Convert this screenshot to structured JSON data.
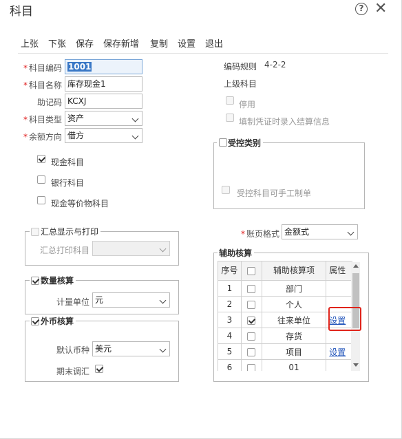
{
  "dialog": {
    "title": "科目"
  },
  "toolbar": {
    "prev": "上张",
    "next": "下张",
    "save": "保存",
    "save_new": "保存新增",
    "copy": "复制",
    "settings": "设置",
    "exit": "退出"
  },
  "form": {
    "code_label": "科目编码",
    "code_value": "1001",
    "name_label": "科目名称",
    "name_value": "库存现金1",
    "mnemonic_label": "助记码",
    "mnemonic_value": "KCXJ",
    "type_label": "科目类型",
    "type_value": "资产",
    "direction_label": "余额方向",
    "direction_value": "借方",
    "cash_label": "现金科目",
    "bank_label": "银行科目",
    "equiv_label": "现金等价物科目"
  },
  "right": {
    "code_rule_label": "编码规则",
    "code_rule_value": "4-2-2",
    "parent_label": "上级科目",
    "disabled_label": "停用",
    "settle_label": "填制凭证时录入结算信息",
    "controlled_legend": "受控类别",
    "manual_label": "受控科目可手工制单",
    "ledger_label": "账页格式",
    "ledger_value": "金额式",
    "aux_legend": "辅助核算"
  },
  "summary": {
    "legend": "汇总显示与打印",
    "print_label": "汇总打印科目",
    "print_value": ""
  },
  "quantity": {
    "legend": "数量核算",
    "unit_label": "计量单位",
    "unit_value": "元"
  },
  "foreign": {
    "legend": "外币核算",
    "currency_label": "默认币种",
    "currency_value": "美元",
    "adjust_label": "期末调汇"
  },
  "aux_table": {
    "headers": {
      "seq": "序号",
      "item": "辅助核算项",
      "attr": "属性"
    },
    "rows": [
      {
        "seq": "1",
        "name": "部门",
        "checked": false,
        "attr": ""
      },
      {
        "seq": "2",
        "name": "个人",
        "checked": false,
        "attr": ""
      },
      {
        "seq": "3",
        "name": "往来单位",
        "checked": true,
        "attr": "设置"
      },
      {
        "seq": "4",
        "name": "存货",
        "checked": false,
        "attr": ""
      },
      {
        "seq": "5",
        "name": "项目",
        "checked": false,
        "attr": "设置"
      },
      {
        "seq": "6",
        "name": "01",
        "checked": false,
        "attr": ""
      }
    ]
  },
  "colors": {
    "required": "#e02020",
    "link": "#2255bb",
    "highlight": "#e0241b",
    "selection": "#3a78c6"
  }
}
